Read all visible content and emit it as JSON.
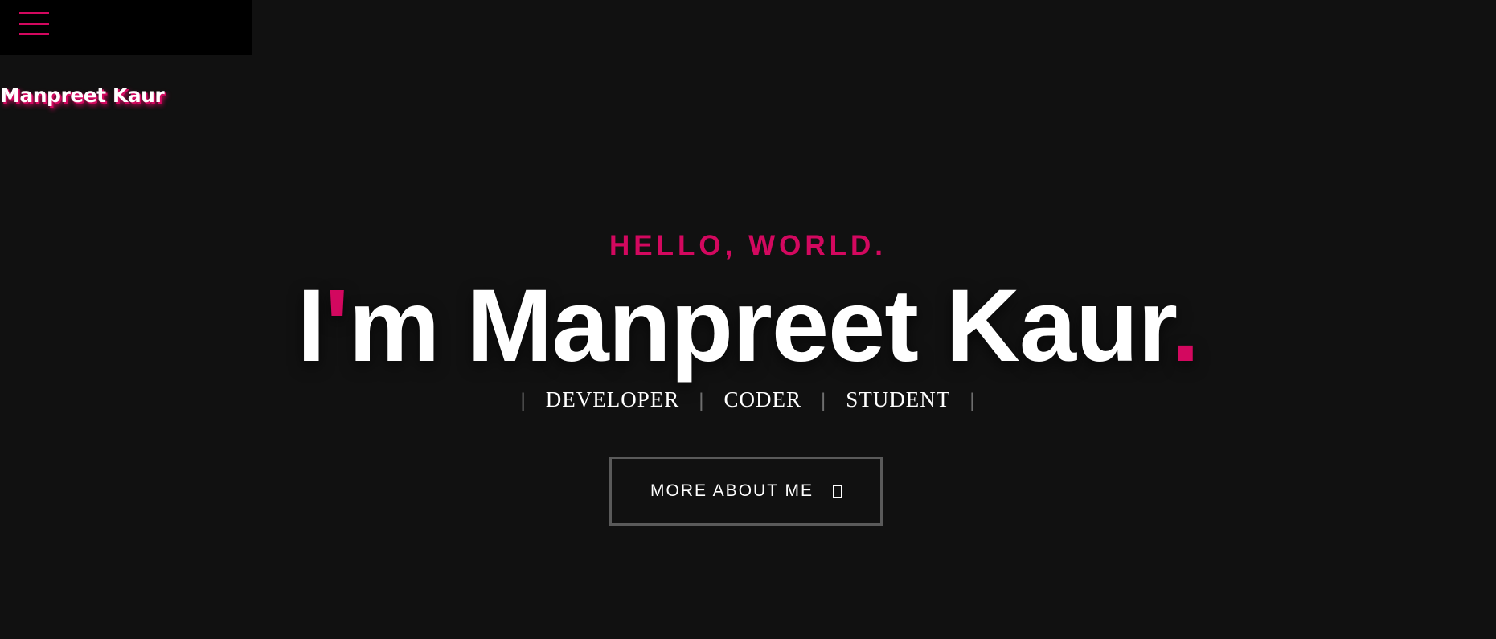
{
  "nav": {
    "menu_icon": "hamburger-menu-icon",
    "site_name": "Manpreet Kaur"
  },
  "hero": {
    "greeting": "HELLO, WORLD.",
    "headline_part1": "I",
    "headline_apostrophe": "'",
    "headline_part2": "m Manpreet Kaur",
    "headline_period": ".",
    "roles": [
      "DEVELOPER",
      "CODER",
      "STUDENT"
    ],
    "cta_label": "MORE ABOUT ME",
    "cta_icon": "missing-glyph-icon"
  },
  "colors": {
    "background": "#111111",
    "menu_bar": "#000000",
    "accent": "#d3085f",
    "text": "#ffffff",
    "button_border": "#5a5a5a"
  }
}
